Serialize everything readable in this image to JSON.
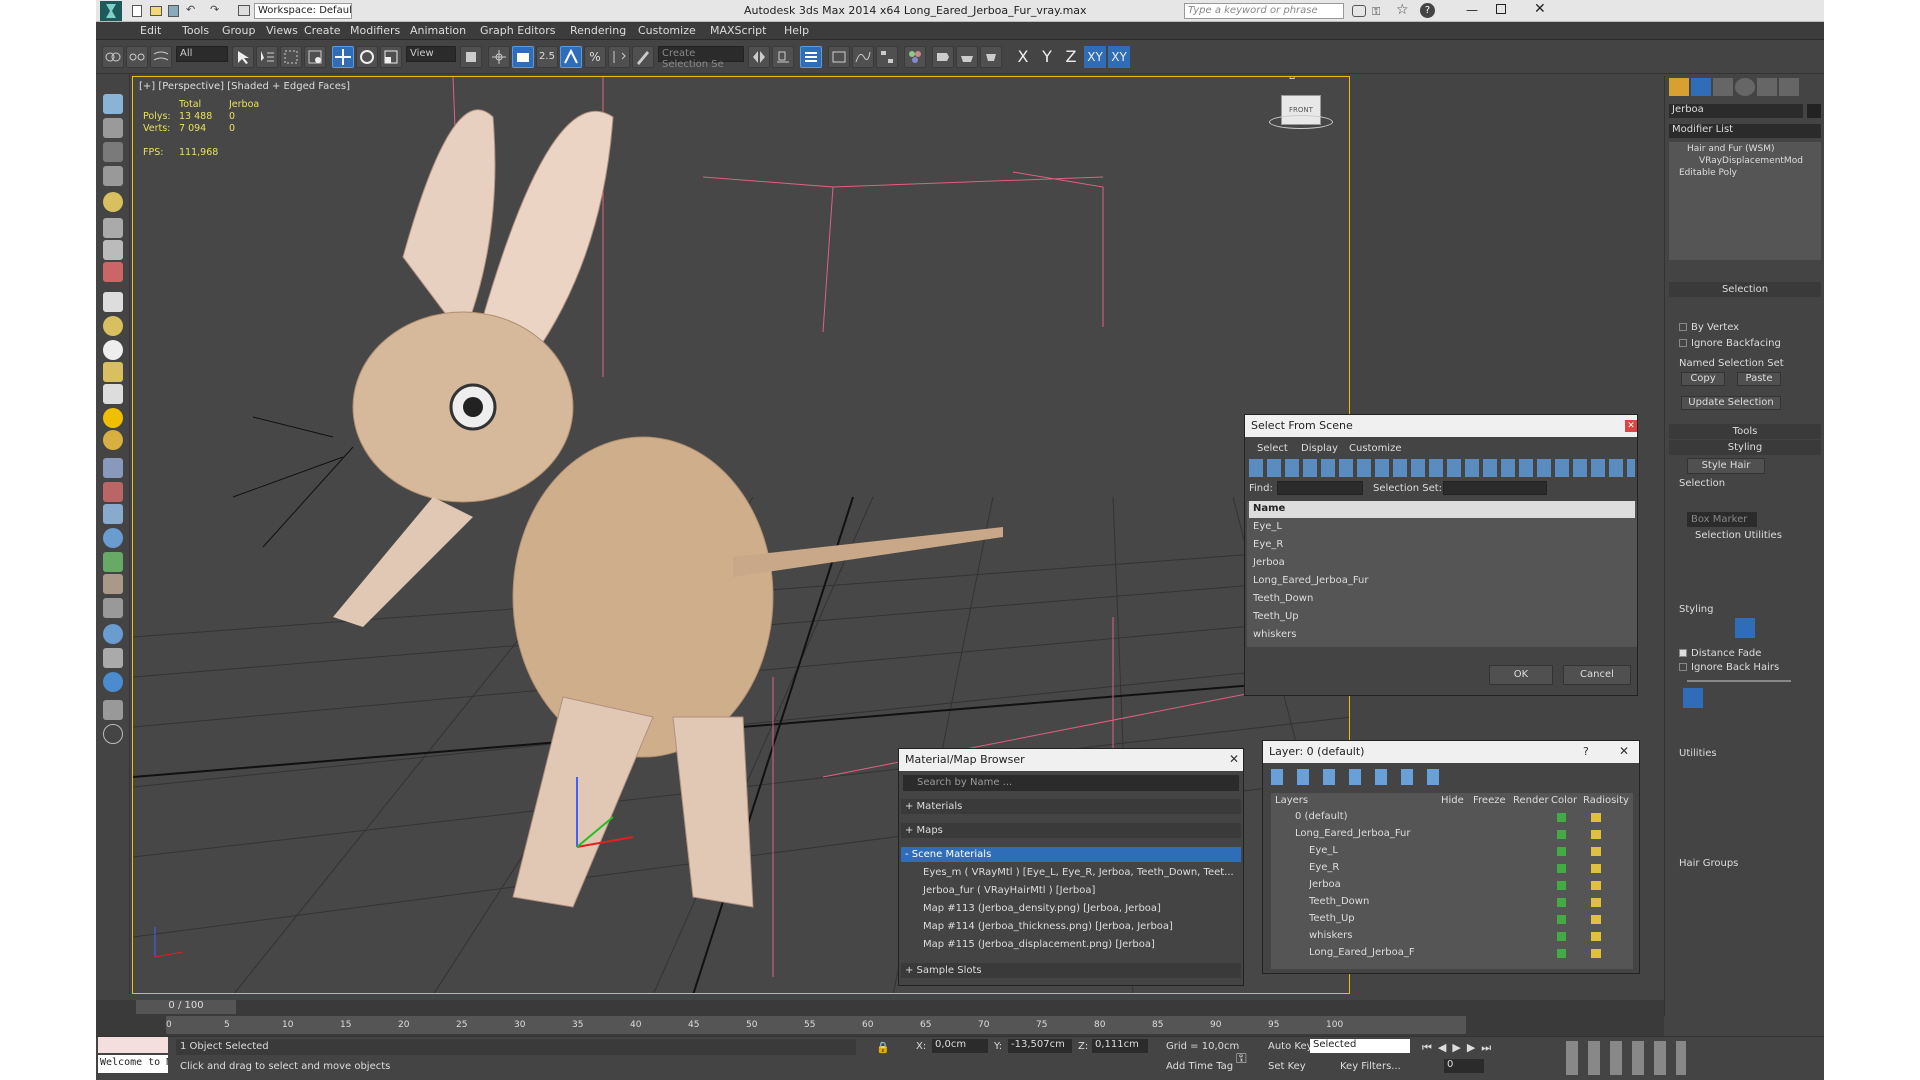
{
  "title_bar": {
    "workspace_label": "Workspace: Default",
    "title": "Autodesk 3ds Max  2014 x64     Long_Eared_Jerboa_Fur_vray.max",
    "search_placeholder": "Type a keyword or phrase"
  },
  "menu": [
    "Edit",
    "Tools",
    "Group",
    "Views",
    "Create",
    "Modifiers",
    "Animation",
    "Graph Editors",
    "Rendering",
    "Customize",
    "MAXScript",
    "Help"
  ],
  "toolbar": {
    "filter_value": "All",
    "view_value": "View",
    "selection_set_placeholder": "Create Selection Se",
    "angle_snap": "2.5",
    "percent_snap": "%",
    "axes": [
      "X",
      "Y",
      "Z",
      "XY",
      "XY"
    ]
  },
  "viewport": {
    "label": "[+] [Perspective] [Shaded + Edged Faces]",
    "stats": {
      "total_label": "Total",
      "object_label": "Jerboa",
      "polys_label": "Polys:",
      "polys_total": "13 488",
      "polys_obj": "0",
      "verts_label": "Verts:",
      "verts_total": "7 094",
      "verts_obj": "0",
      "fps_label": "FPS:",
      "fps_value": "111,968"
    },
    "viewcube_label": "FRONT"
  },
  "command_panel": {
    "object_name": "Jerboa",
    "modifier_list_label": "Modifier List",
    "stack": [
      "Hair and Fur (WSM)",
      "VRayDisplacementMod",
      "Editable Poly"
    ],
    "selection_header": "Selection",
    "by_vertex": "By Vertex",
    "ignore_backfacing": "Ignore Backfacing",
    "named_sel_label": "Named Selection Set",
    "copy": "Copy",
    "paste": "Paste",
    "update_selection": "Update Selection",
    "tools_header": "Tools",
    "styling_header": "Styling",
    "style_hair": "Style Hair",
    "sel_label": "Selection",
    "box_marker": "Box Marker",
    "sel_utilities": "Selection Utilities",
    "styling_label": "Styling",
    "distance_fade": "Distance Fade",
    "ignore_back_hairs": "Ignore Back Hairs",
    "utilities_label": "Utilities",
    "hair_groups_label": "Hair Groups"
  },
  "select_from_scene": {
    "title": "Select From Scene",
    "menu": [
      "Select",
      "Display",
      "Customize"
    ],
    "find_label": "Find:",
    "selection_set_label": "Selection Set:",
    "column_name": "Name",
    "items": [
      "Eye_L",
      "Eye_R",
      "Jerboa",
      "Long_Eared_Jerboa_Fur",
      "Teeth_Down",
      "Teeth_Up",
      "whiskers"
    ],
    "ok": "OK",
    "cancel": "Cancel"
  },
  "material_browser": {
    "title": "Material/Map Browser",
    "search_placeholder": "Search by Name ...",
    "groups": [
      "+ Materials",
      "+ Maps",
      "- Scene Materials"
    ],
    "scene_items": [
      "Eyes_m  ( VRayMtl )  [Eye_L, Eye_R, Jerboa, Teeth_Down, Teet...",
      "Jerboa_fur  ( VRayHairMtl )  [Jerboa]",
      "Map #113 (Jerboa_density.png)  [Jerboa, Jerboa]",
      "Map #114 (Jerboa_thickness.png)  [Jerboa, Jerboa]",
      "Map #115 (Jerboa_displacement.png)  [Jerboa]"
    ],
    "sample_slots": "+ Sample Slots"
  },
  "layer_dialog": {
    "title": "Layer: 0 (default)",
    "help": "?",
    "columns": [
      "Layers",
      "Hide",
      "Freeze",
      "Render",
      "Color",
      "Radiosity"
    ],
    "rows": [
      "0 (default)",
      "Long_Eared_Jerboa_Fur",
      "Eye_L",
      "Eye_R",
      "Jerboa",
      "Teeth_Down",
      "Teeth_Up",
      "whiskers",
      "Long_Eared_Jerboa_F"
    ]
  },
  "timeline": {
    "frame_counter": "0 / 100",
    "ticks": [
      "0",
      "5",
      "10",
      "15",
      "20",
      "25",
      "30",
      "35",
      "40",
      "45",
      "50",
      "55",
      "60",
      "65",
      "70",
      "75",
      "80",
      "85",
      "90",
      "95",
      "100"
    ]
  },
  "status": {
    "maxscript": "Welcome to M",
    "selected": "1 Object Selected",
    "prompt": "Click and drag to select and move objects",
    "x_label": "X:",
    "x_value": "0,0cm",
    "y_label": "Y:",
    "y_value": "-13,507cm",
    "z_label": "Z:",
    "z_value": "0,111cm",
    "grid": "Grid = 10,0cm",
    "add_time_tag": "Add Time Tag",
    "auto_key": "Auto Key",
    "set_key": "Set Key",
    "selected_dropdown": "Selected",
    "key_filters": "Key Filters...",
    "frame": "0"
  },
  "colors": {
    "accent": "#2f6db8",
    "viewport_border": "#f0c000",
    "grid": "#2a2a2a"
  }
}
